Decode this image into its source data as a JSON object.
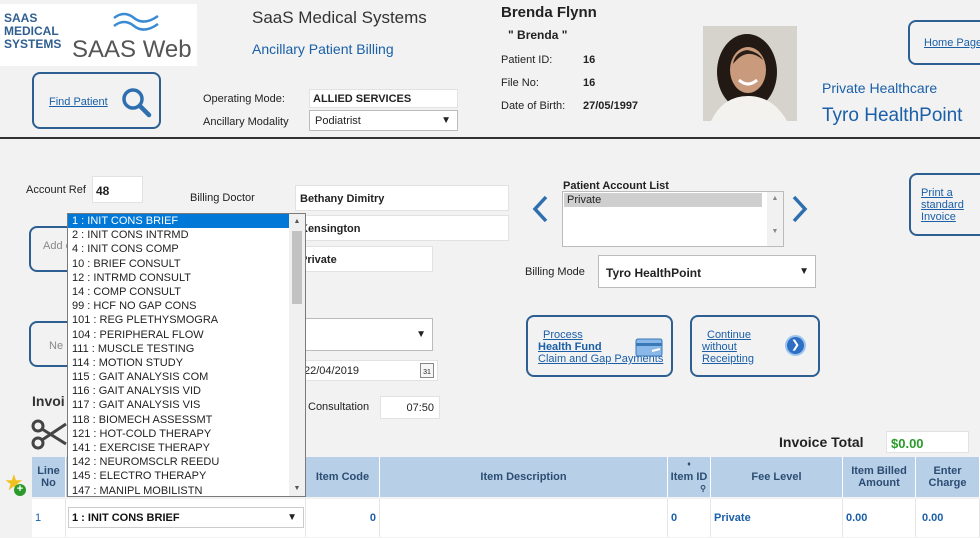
{
  "logo": {
    "lines": [
      "SAAS",
      "MEDICAL",
      "SYSTEMS"
    ],
    "brand": "SAAS Web"
  },
  "header": {
    "company": "SaaS Medical Systems",
    "module": "Ancillary Patient Billing"
  },
  "find_patient": {
    "label": "Find Patient",
    "icon": "search-icon"
  },
  "operating_mode": {
    "label": "Operating Mode:",
    "value": "ALLIED SERVICES"
  },
  "ancillary_modality": {
    "label": "Ancillary Modality",
    "value": "Podiatrist"
  },
  "patient": {
    "name": "Brenda Flynn",
    "nickname": "\" Brenda \"",
    "id_label": "Patient ID:",
    "id": "16",
    "file_label": "File No:",
    "file": "16",
    "dob_label": "Date of Birth:",
    "dob": "27/05/1997"
  },
  "insurer": {
    "type": "Private Healthcare",
    "name": "Tyro HealthPoint"
  },
  "home_page": "Home Page",
  "account_ref": {
    "label": "Account Ref",
    "value": "48"
  },
  "billing_doctor": {
    "label": "Billing Doctor",
    "value": "Bethany Dimitry",
    "location": "Kensington",
    "type": "Private"
  },
  "add_button": "Add c",
  "new_button": "Ne",
  "date_value": "22/04/2019",
  "consultation": {
    "label": "Consultation",
    "time": "07:50"
  },
  "invoice_heading": "Invoi",
  "patient_account_list": {
    "label": "Patient Account List",
    "items": [
      "Private"
    ]
  },
  "billing_mode": {
    "label": "Billing Mode",
    "value": "Tyro HealthPoint"
  },
  "print_invoice": "Print a standard Invoice",
  "process_fund": {
    "line1": "Process",
    "line2": "Health Fund",
    "line3": "Claim and Gap Payments"
  },
  "continue_btn": {
    "line1": "Continue",
    "line2": "without",
    "line3": "Receipting"
  },
  "invoice_total": {
    "label": "Invoice Total",
    "value": "$0.00"
  },
  "item_dropdown": {
    "items": [
      "1 : INIT CONS BRIEF",
      "2 : INIT CONS INTRMD",
      "4 : INIT CONS COMP",
      "10 : BRIEF CONSULT",
      "12 : INTRMD CONSULT",
      "14 : COMP CONSULT",
      "99 : HCF NO GAP CONS",
      "101 : REG PLETHYSMOGRA",
      "104 : PERIPHERAL FLOW",
      "111 : MUSCLE TESTING",
      "114 : MOTION STUDY",
      "115 : GAIT ANALYSIS COM",
      "116 : GAIT ANALYSIS VID",
      "117 : GAIT ANALYSIS VIS",
      "118 : BIOMECH ASSESSMT",
      "121 : HOT-COLD THERAPY",
      "141 : EXERCISE THERAPY",
      "142 : NEUROMSCLR REEDU",
      "145 : ELECTRO THERAPY",
      "147 : MANIPL MOBILISTN"
    ]
  },
  "table": {
    "headers": {
      "line": "Line No",
      "item": "Item Code",
      "desc": "Item Description",
      "itemid": "Item ID",
      "fee": "Fee Level",
      "billed": "Item Billed Amount",
      "enter": "Enter Charge"
    },
    "row": {
      "line": "1",
      "item_select": "1 : INIT CONS BRIEF",
      "item_code": "0",
      "item_id": "0",
      "fee": "Private",
      "billed": "0.00",
      "enter": "0.00"
    }
  },
  "colors": {
    "accent": "#2e5f92",
    "header_bg": "#b8cfe8",
    "total_green": "#2a9a2a"
  }
}
